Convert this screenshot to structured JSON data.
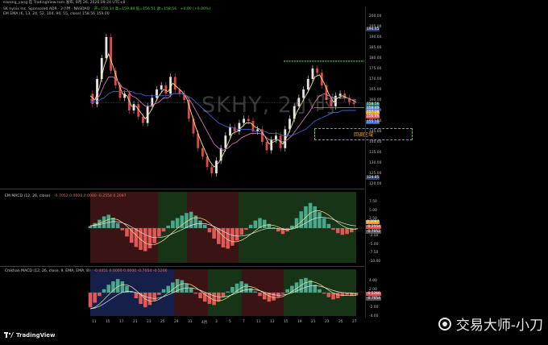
{
  "header": {
    "top_line": "eiwong_yang 在 TradingView.com 发布, 8月 26, 2026 09:24 UTC+8",
    "symbol_line": "SK hynix Inc. Sponsored ADR · 2小时 · NASDAQ",
    "ohlc": "开=158.34  高=159.88  低=156.51  收=158.56",
    "change": "+0.00 (+0.00%)",
    "ema_line": "EM EMA (6, 13, 24, 52, 104, 90, 55, close)  158.56  159.00",
    "macd_title": "EM MACD (12, 26, close)",
    "macd_values": "-0.7052  0.0000  0.0000  -0.2554  0.2097",
    "chikhan_title": "Chikhan MACD (12, 26, close, 9, EMA, EMA, 8)",
    "chikhan_values": "-0.4451  0.0000  0.0000  -0.7054  -0.5266"
  },
  "watermark": "SKHY, 2小时",
  "zone_label": "回调区域",
  "axis": {
    "main_ticks": [
      "200.00",
      "195.00",
      "190.00",
      "185.00",
      "180.00",
      "175.00",
      "170.00",
      "165.00",
      "160.00",
      "155.00",
      "150.00",
      "145.00",
      "140.00",
      "135.00",
      "130.00",
      "125.00",
      "120.00"
    ],
    "macd_ticks": [
      "7.50",
      "5.00",
      "2.50",
      "0.00",
      "-2.50",
      "-5.00",
      "-7.50",
      "-10.00"
    ],
    "chikhan_ticks": [
      "4.00",
      "2.00",
      "0.00",
      "-2.00",
      "-4.00"
    ],
    "x_ticks": [
      "11",
      "15",
      "17",
      "21",
      "23",
      "25",
      "29",
      "31",
      "4月",
      "3",
      "5",
      "7",
      "11",
      "13",
      "15",
      "19",
      "21",
      "23",
      "25",
      "27"
    ]
  },
  "price_labels": [
    {
      "text": "194.45",
      "color": "#2e3e66"
    },
    {
      "text": "158.56",
      "color": "#1f6e5a"
    },
    {
      "text": "158.40",
      "color": "#5b7fcf"
    },
    {
      "text": "157.28",
      "color": "#d8a030"
    },
    {
      "text": "156.89",
      "color": "#e55b5b"
    },
    {
      "text": "155.10",
      "color": "#3a62c0"
    },
    {
      "text": "124.85",
      "color": "#2e3e66"
    }
  ],
  "macd_labels": [
    {
      "text": "0.2097",
      "color": "#e0a030"
    },
    {
      "text": "-0.2554",
      "color": "#d85050"
    },
    {
      "text": "-0.7052",
      "color": "#555555"
    }
  ],
  "chikhan_labels": [
    {
      "text": "-0.5266",
      "color": "#d85050"
    },
    {
      "text": "-0.7054",
      "color": "#555555"
    }
  ],
  "footer": {
    "logo_text": "TradingView"
  },
  "brand": "交易大师-小刀",
  "chart_data": {
    "type": "line",
    "title": "SKHY, 2小时",
    "ylim": [
      120,
      200
    ],
    "note_zone": "回调区域",
    "series": [
      {
        "name": "close",
        "color": "#e6e6e6",
        "values": [
          163,
          158,
          170,
          180,
          190,
          174,
          167,
          161,
          163,
          155,
          158,
          152,
          149,
          157,
          161,
          165,
          167,
          163,
          171,
          165,
          163,
          160,
          151,
          144,
          137,
          133,
          128,
          125,
          131,
          137,
          143,
          147,
          145,
          149,
          151,
          150,
          145,
          146,
          140,
          136,
          141,
          143,
          137,
          146,
          151,
          157,
          161,
          165,
          170,
          175,
          173,
          167,
          160,
          157,
          162,
          163,
          161,
          159,
          158
        ]
      },
      {
        "name": "EMA fast",
        "color": "#f0e68c",
        "values": [
          162,
          160,
          166,
          176,
          182,
          176,
          169,
          163,
          162,
          157,
          157,
          154,
          151,
          154,
          158,
          162,
          165,
          164,
          168,
          166,
          164,
          161,
          154,
          147,
          141,
          136,
          131,
          128,
          130,
          134,
          139,
          144,
          145,
          147,
          149,
          149,
          147,
          146,
          143,
          139,
          140,
          141,
          139,
          143,
          148,
          154,
          158,
          162,
          166,
          171,
          172,
          168,
          163,
          159,
          161,
          162,
          161,
          160,
          159
        ]
      },
      {
        "name": "EMA slow",
        "color": "#d070c0",
        "values": [
          160,
          160,
          162,
          167,
          171,
          171,
          169,
          166,
          165,
          162,
          161,
          159,
          157,
          157,
          158,
          159,
          161,
          161,
          163,
          163,
          163,
          162,
          159,
          155,
          151,
          147,
          143,
          139,
          137,
          136,
          137,
          139,
          140,
          142,
          143,
          144,
          144,
          144,
          143,
          141,
          141,
          141,
          140,
          141,
          143,
          146,
          149,
          152,
          155,
          159,
          162,
          163,
          162,
          161,
          161,
          161,
          161,
          160,
          160
        ]
      },
      {
        "name": "EMA trend",
        "color": "#3a62c0",
        "values": [
          159,
          159,
          160,
          161,
          163,
          164,
          164,
          164,
          164,
          164,
          163,
          163,
          162,
          162,
          162,
          162,
          162,
          162,
          163,
          163,
          163,
          162,
          161,
          159,
          157,
          155,
          153,
          151,
          149,
          148,
          147,
          147,
          146,
          146,
          146,
          146,
          145,
          145,
          145,
          144,
          144,
          144,
          143,
          143,
          143,
          144,
          145,
          146,
          148,
          150,
          151,
          152,
          153,
          154,
          154,
          155,
          155,
          155,
          155
        ]
      }
    ],
    "levels": [
      {
        "name": "top",
        "value": 178.5,
        "color": "#3ecf3e"
      },
      {
        "name": "support",
        "value": 156.3,
        "color": "#3ecf3e"
      }
    ],
    "macd_hist": [
      0.5,
      1.2,
      2.0,
      2.8,
      3.2,
      2.5,
      1.2,
      -0.5,
      -2.0,
      -3.5,
      -4.5,
      -5.2,
      -5.5,
      -4.8,
      -3.6,
      -2.0,
      -0.8,
      0.6,
      1.8,
      2.4,
      3.0,
      3.6,
      3.9,
      3.0,
      1.8,
      0.8,
      -1.0,
      -2.5,
      -3.8,
      -4.6,
      -4.9,
      -4.2,
      -3.0,
      -1.6,
      -0.4,
      0.8,
      1.8,
      2.4,
      2.0,
      1.0,
      0.2,
      -0.8,
      -1.4,
      -0.8,
      0.6,
      2.4,
      4.0,
      5.2,
      6.0,
      5.2,
      3.8,
      2.4,
      1.0,
      -0.4,
      -1.2,
      -1.6,
      -1.4,
      -1.0,
      -0.3
    ],
    "chikhan_hist": [
      -2.6,
      -1.8,
      -0.6,
      0.6,
      1.4,
      2.0,
      2.4,
      2.0,
      1.2,
      0.2,
      -1.0,
      -2.0,
      -2.6,
      -2.2,
      -1.4,
      -0.4,
      0.6,
      1.2,
      1.8,
      2.4,
      2.2,
      1.6,
      0.8,
      -0.2,
      -1.0,
      -1.6,
      -2.0,
      -2.2,
      -1.6,
      -0.8,
      0.2,
      1.0,
      1.6,
      2.0,
      1.6,
      0.8,
      0.2,
      -0.6,
      -1.2,
      -1.6,
      -1.4,
      -0.8,
      -0.2,
      0.6,
      1.2,
      1.8,
      2.4,
      2.6,
      2.2,
      1.4,
      0.6,
      -0.2,
      -0.8,
      -1.2,
      -1.0,
      -0.6,
      -0.4,
      -0.6,
      -0.5
    ]
  }
}
